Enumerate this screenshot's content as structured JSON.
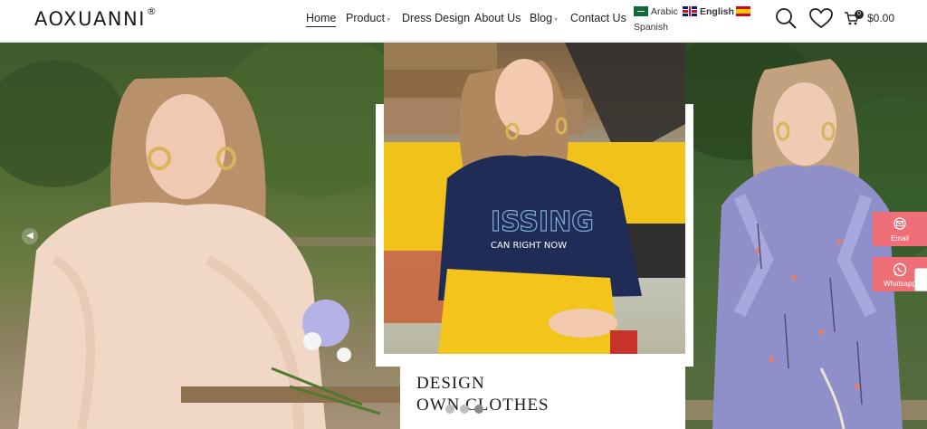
{
  "brand": {
    "name": "AOXUANNI",
    "mark": "®"
  },
  "nav": {
    "home": "Home",
    "product": "Product",
    "dress_design": "Dress Design",
    "about": "About Us",
    "blog": "Blog",
    "contact": "Contact Us"
  },
  "languages": {
    "arabic": "Arabic",
    "english": "English",
    "spanish": "Spanish"
  },
  "cart": {
    "count": "0",
    "total": "$0.00"
  },
  "icons": [
    "search-icon",
    "heart-icon",
    "cart-icon",
    "chevron-left-icon",
    "email-icon",
    "whatsapp-icon"
  ],
  "hero": {
    "line1": "DESIGN",
    "line2": "OWN CLOTHES",
    "shirt_text_1": "ISSING",
    "shirt_text_2": "CAN RIGHT NOW"
  },
  "contact_buttons": {
    "email": "Email",
    "whatsapp": "Whatsapp"
  },
  "colors": {
    "accent": "#ee6f78",
    "dark": "#222222"
  }
}
